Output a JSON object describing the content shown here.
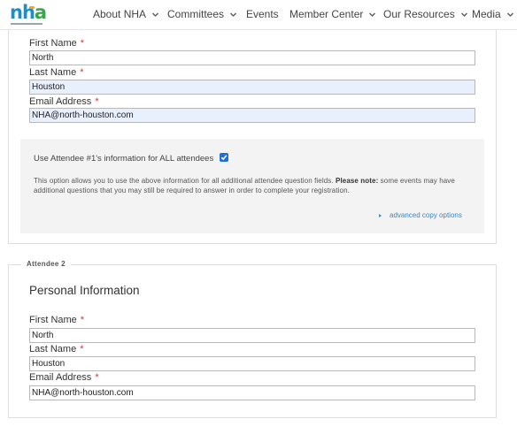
{
  "header": {
    "logo_text": "nha",
    "nav": [
      {
        "label": "About NHA",
        "has_dropdown": true
      },
      {
        "label": "Committees",
        "has_dropdown": true
      },
      {
        "label": "Events",
        "has_dropdown": false
      },
      {
        "label": "Member Center",
        "has_dropdown": true
      },
      {
        "label": "Our Resources",
        "has_dropdown": true
      },
      {
        "label": "Media",
        "has_dropdown": true
      }
    ]
  },
  "attendee1": {
    "first_name_label": "First Name",
    "first_name_value": "North",
    "last_name_label": "Last Name",
    "last_name_value": "Houston",
    "email_label": "Email Address",
    "email_value": "NHA@north-houston.com",
    "required_marker": "*"
  },
  "copy_options": {
    "checkbox_label": "Use Attendee #1's information for ALL attendees",
    "checked": true,
    "description_before": "This option allows you to use the above information for all additional attendee question fields. ",
    "description_bold": "Please note:",
    "description_after": " some events may have additional questions that you may still be required to answer in order to complete your registration.",
    "advanced_link": "advanced copy options"
  },
  "attendee2": {
    "legend": "Attendee 2",
    "section_title": "Personal Information",
    "first_name_label": "First Name",
    "first_name_value": "North",
    "last_name_label": "Last Name",
    "last_name_value": "Houston",
    "email_label": "Email Address",
    "email_value": "NHA@north-houston.com",
    "required_marker": "*"
  },
  "colors": {
    "accent": "#1e6fd6",
    "link": "#3a86c8",
    "required": "#d0363a",
    "autofill_bg": "#e8f0fe"
  }
}
